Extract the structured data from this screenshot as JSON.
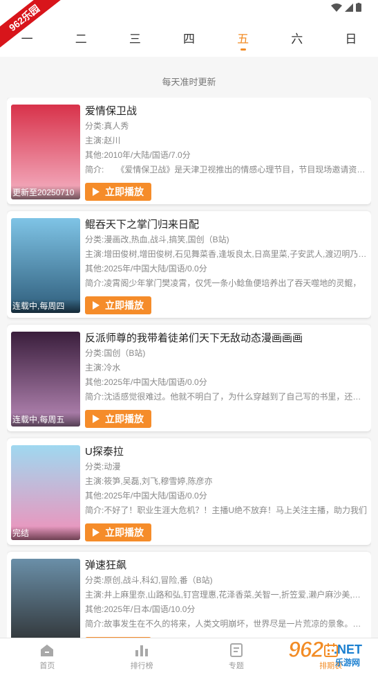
{
  "ribbon": "962乐园",
  "day_tabs": [
    "一",
    "二",
    "三",
    "四",
    "五",
    "六",
    "日"
  ],
  "active_day_index": 4,
  "subtitle": "每天准时更新",
  "play_label": "立即播放",
  "items": [
    {
      "title": "爱情保卫战",
      "category": "分类:真人秀",
      "cast": "主演:赵川",
      "other": "其他:2010年/大陆/国语/7.0分",
      "intro": "简介:　　《爱情保卫战》是天津卫视推出的情感心理节目，节目现场邀请资深情感专家",
      "poster_caption": "更新至20250710",
      "poster_colors": [
        "#d8324a",
        "#f5b4c6"
      ]
    },
    {
      "title": "鲲吞天下之掌门归来日配",
      "category": "分类:漫画改,热血,战斗,搞笑,国创（B站)",
      "cast": "主演:增田俊树,增田俊树,石见舞菜香,逢坂良太,日高里菜,子安武人,渡辺明乃,前野智昭",
      "other": "其他:2025年/中国大陆/国语/0.0分",
      "intro": "简介:凌霄阁少年掌门樊凌霄，仅凭一条小鲶鱼便培养出了吞天噬地的灵鲲，",
      "poster_caption": "连载中,每周四",
      "poster_colors": [
        "#7fc4e6",
        "#2e5c7a"
      ]
    },
    {
      "title": "反派师尊的我带着徒弟们天下无敌动态漫画画画",
      "category": "分类:国创（B站)",
      "cast": "主演:冷水",
      "other": "其他:2025年/中国大陆/国语/0.0分",
      "intro": "简介:沈适感觉很难过。他就不明白了，为什么穿越到了自己写的书里，还不是主角",
      "poster_caption": "连载中,每周五",
      "poster_colors": [
        "#3a1e3c",
        "#b98ab8"
      ]
    },
    {
      "title": "U探泰拉",
      "category": "分类:动漫",
      "cast": "主演:筱笋,吴磊,刘飞,穆雪婷,陈彦亦",
      "other": "其他:2025年/中国大陆/国语/0.0分",
      "intro": "简介:不好了！职业生涯大危机？！主播U绝不放弃！马上关注主播，助力我们",
      "poster_caption": "完结",
      "poster_colors": [
        "#9fd8f0",
        "#f28fb8"
      ]
    },
    {
      "title": "弹速狂飙",
      "category": "分类:原创,战斗,科幻,冒险,番（B站)",
      "cast": "主演:井上麻里奈,山路和弘,钉宫理惠,花泽香菜,关智一,折笠爱,濑户麻沙美,古川登志夫",
      "other": "其他:2025年/日本/国语/10.0分",
      "intro": "简介:故事发生在不久的将来，人类文明崩坏，世界尽是一片荒凉的景象。在这里",
      "poster_caption": "",
      "poster_colors": [
        "#6a8fa8",
        "#2a2a2a"
      ]
    }
  ],
  "bottom_nav": [
    {
      "label": "首页",
      "icon": "home-icon"
    },
    {
      "label": "排行榜",
      "icon": "ranking-icon"
    },
    {
      "label": "专题",
      "icon": "topic-icon"
    },
    {
      "label": "排期表",
      "icon": "calendar-icon"
    }
  ],
  "active_nav_index": 3,
  "watermark": {
    "big": "962",
    "net": ".NET",
    "small": "乐游网"
  },
  "accent_color": "#f28c26"
}
